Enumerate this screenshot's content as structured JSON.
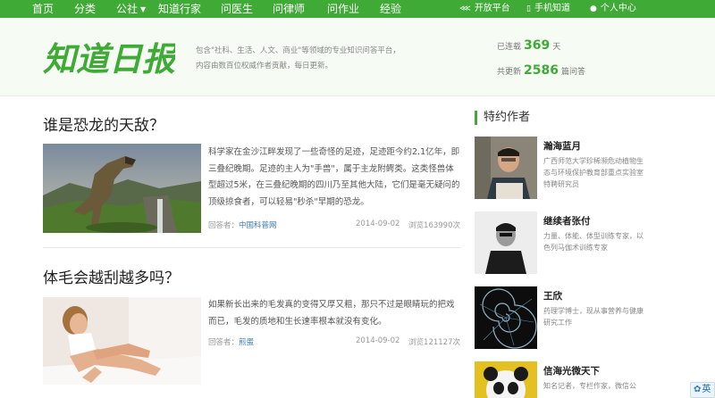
{
  "nav": {
    "items": [
      "首页",
      "分类",
      "公社",
      "知道行家",
      "问医生",
      "问律师",
      "问作业",
      "经验"
    ],
    "right": [
      {
        "label": "开放平台",
        "icon": "share-icon"
      },
      {
        "label": "手机知道",
        "icon": "mobile-icon"
      },
      {
        "label": "个人中心",
        "icon": "user-icon"
      }
    ]
  },
  "header": {
    "logo_text": "知道日报",
    "tagline": "包含\"社科、生活、人文、商业\"等领域的专业知识问答平台，内容由数百位权威作者贡献，每日更新。",
    "stats": {
      "days_prefix": "已连载",
      "days_value": "369",
      "days_suffix": "天",
      "updates_prefix": "共更新",
      "updates_value": "2586",
      "updates_suffix": "篇问答"
    }
  },
  "articles": [
    {
      "title": "谁是恐龙的天敌？",
      "excerpt": "科学家在金沙江畔发现了一些奇怪的足迹，足迹距今约2.1亿年，即三叠纪晚期。足迹的主人为\"手兽\"，属于主龙附鳄类。这类怪兽体型超过5米，在三叠纪晚期的四川乃至其他大陆，它们是毫无疑问的顶级掠食者，可以轻易\"秒杀\"早期的恐龙。",
      "author_label": "回答者：",
      "author": "中国科普网",
      "date": "2014-09-02",
      "views": "浏览163990次"
    },
    {
      "title": "体毛会越刮越多吗？",
      "excerpt": "如果新长出来的毛发真的变得又厚又粗，那只不过是眼睛玩的把戏而已，毛发的质地和生长速率根本就没有变化。",
      "author_label": "回答者：",
      "author": "煎蛋",
      "date": "2014-09-02",
      "views": "浏览121127次"
    }
  ],
  "sidebar": {
    "heading": "特约作者",
    "authors": [
      {
        "name": "瀚海蓝月",
        "desc": "广西师范大学珍稀濒危动植物生态与环境保护教育部重点实验室特聘研究员"
      },
      {
        "name": "继续者张付",
        "desc": "力量、体能、体型训练专家，以色列马伽术训练专家"
      },
      {
        "name": "王欣",
        "desc": "药理学博士，现从事营养与健康研究工作"
      },
      {
        "name": "信海光微天下",
        "desc": "知名记者，专栏作家，微信公"
      }
    ]
  },
  "float_widget": {
    "label": "英"
  },
  "colors": {
    "brand_green": "#3fab36",
    "link_blue": "#3b7ab8"
  }
}
